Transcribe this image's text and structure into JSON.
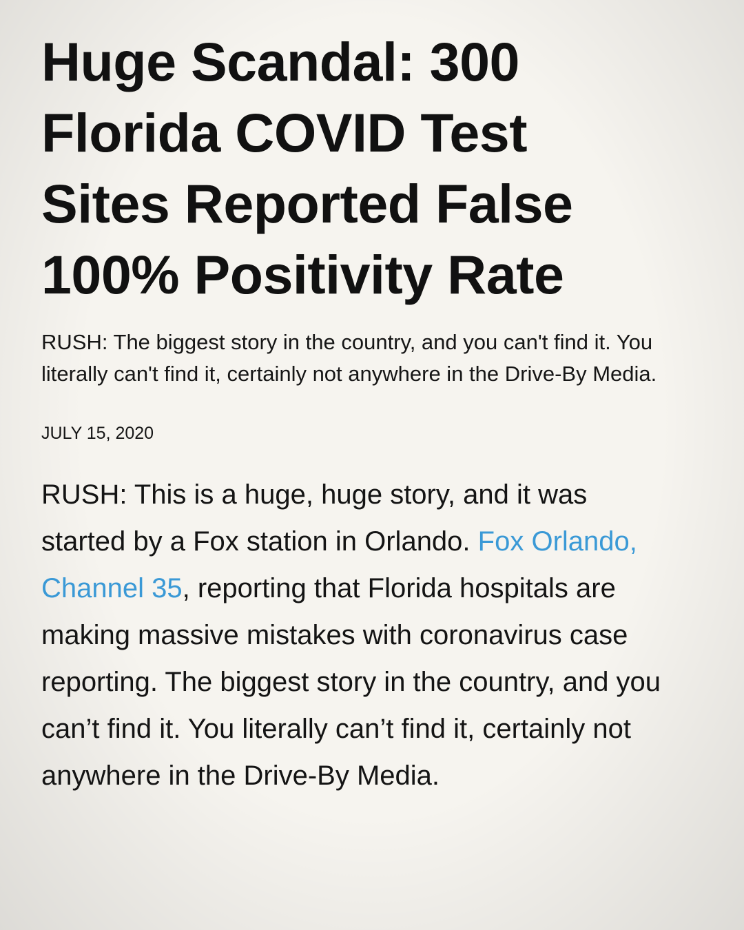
{
  "article": {
    "headline": "Huge Scandal: 300 Florida COVID Test Sites Reported False 100% Positivity Rate",
    "dek": "RUSH: The biggest story in the country, and you can't find it. You literally can't find it, certainly not anywhere in the Drive-By Media.",
    "date": "JULY 15, 2020",
    "body": {
      "intro": "RUSH: This is a huge, huge story, and it was started by a Fox station in Orlando. ",
      "link_text": "Fox Orlando, Channel 35",
      "rest": ", reporting that Florida hospitals are making massive mistakes with coronavirus case reporting. The biggest story in the country, and you can’t find it. You literally can’t find it, certainly not anywhere in the Drive-By Media."
    }
  },
  "colors": {
    "link": "#3a99d6",
    "text": "#111111",
    "background": "#f6f4ef"
  }
}
